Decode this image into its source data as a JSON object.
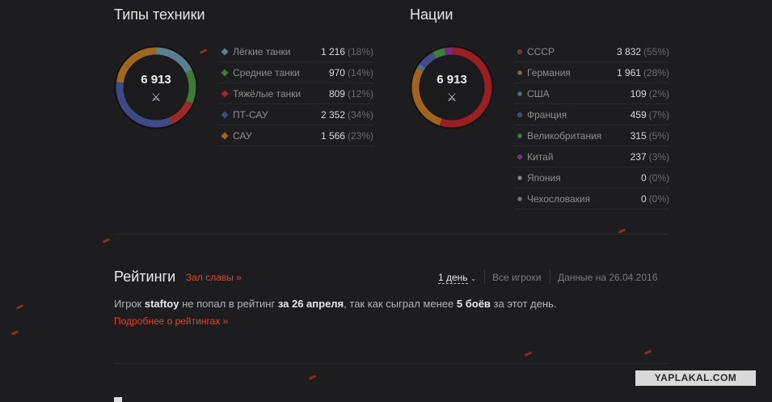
{
  "vehicle_types": {
    "title": "Типы техники",
    "total": "6 913",
    "items": [
      {
        "name": "Лёгкие танки",
        "value": "1 216",
        "pct": "(18%)",
        "share": 18,
        "color": "#5c7f90",
        "icon": "light-tank-icon"
      },
      {
        "name": "Средние танки",
        "value": "970",
        "pct": "(14%)",
        "share": 14,
        "color": "#3f7a32",
        "icon": "medium-tank-icon"
      },
      {
        "name": "Тяжёлые танки",
        "value": "809",
        "pct": "(12%)",
        "share": 12,
        "color": "#9b2a24",
        "icon": "heavy-tank-icon"
      },
      {
        "name": "ПТ-САУ",
        "value": "2 352",
        "pct": "(34%)",
        "share": 34,
        "color": "#3e4a86",
        "icon": "td-icon"
      },
      {
        "name": "САУ",
        "value": "1 566",
        "pct": "(23%)",
        "share": 23,
        "color": "#a2671f",
        "icon": "spg-icon"
      }
    ]
  },
  "nations": {
    "title": "Нации",
    "total": "6 913",
    "items": [
      {
        "name": "СССР",
        "value": "3 832",
        "pct": "(55%)",
        "share": 55,
        "color": "#9b1f22",
        "icon": "ussr-flag-icon"
      },
      {
        "name": "Германия",
        "value": "1 961",
        "pct": "(28%)",
        "share": 28,
        "color": "#a26320",
        "icon": "germany-flag-icon"
      },
      {
        "name": "США",
        "value": "109",
        "pct": "(2%)",
        "share": 2,
        "color": "#4d6f86",
        "icon": "usa-flag-icon"
      },
      {
        "name": "Франция",
        "value": "459",
        "pct": "(7%)",
        "share": 7,
        "color": "#41498a",
        "icon": "france-flag-icon"
      },
      {
        "name": "Великобритания",
        "value": "315",
        "pct": "(5%)",
        "share": 5,
        "color": "#3b7f3a",
        "icon": "uk-flag-icon"
      },
      {
        "name": "Китай",
        "value": "237",
        "pct": "(3%)",
        "share": 3,
        "color": "#7a2a86",
        "icon": "china-flag-icon"
      },
      {
        "name": "Япония",
        "value": "0",
        "pct": "(0%)",
        "share": 0,
        "color": "#8c8c8c",
        "icon": "japan-flag-icon"
      },
      {
        "name": "Чехословакия",
        "value": "0",
        "pct": "(0%)",
        "share": 0,
        "color": "#8a7550",
        "icon": "czech-flag-icon"
      }
    ]
  },
  "ratings": {
    "title": "Рейтинги",
    "hall_link": "Зал славы »",
    "period": "1 день",
    "players": "Все игроки",
    "data_date": "Данные на 26.04.2016",
    "msg_before": "Игрок ",
    "player": "staftoy",
    "msg_mid": " не попал в рейтинг ",
    "date_bold": "за 26 апреля",
    "msg_mid2": ", так как сыграл менее ",
    "battles_bold": "5 боёв",
    "msg_after": " за этот день.",
    "more_link": "Подробнее о рейтингах »"
  },
  "watermark": "YAPLAKAL.COM",
  "colors": {
    "accent": "#e0452c",
    "background": "#1d1d1f"
  }
}
